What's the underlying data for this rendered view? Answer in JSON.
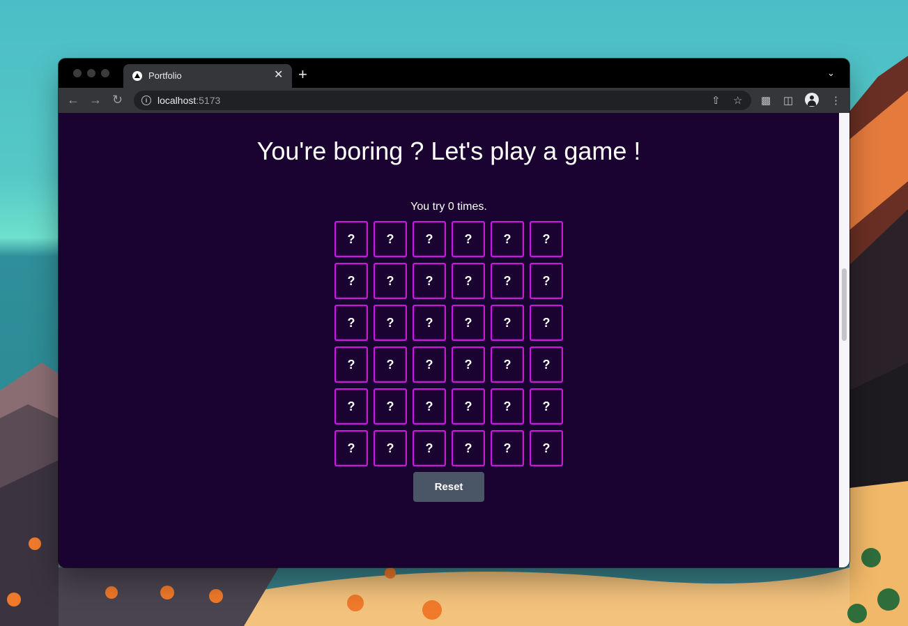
{
  "browser": {
    "tab_title": "Portfolio",
    "tab_close": "✕",
    "new_tab": "+",
    "url_host": "localhost",
    "url_port": ":5173"
  },
  "page": {
    "title": "You're boring ? Let's play a game !",
    "tries_text": "You try 0 times.",
    "reset_label": "Reset"
  },
  "game": {
    "rows": 6,
    "cols": 6,
    "card_hidden_symbol": "?",
    "tries": 0,
    "card_border_color": "#c81bd8",
    "background_color": "#1a0330"
  }
}
